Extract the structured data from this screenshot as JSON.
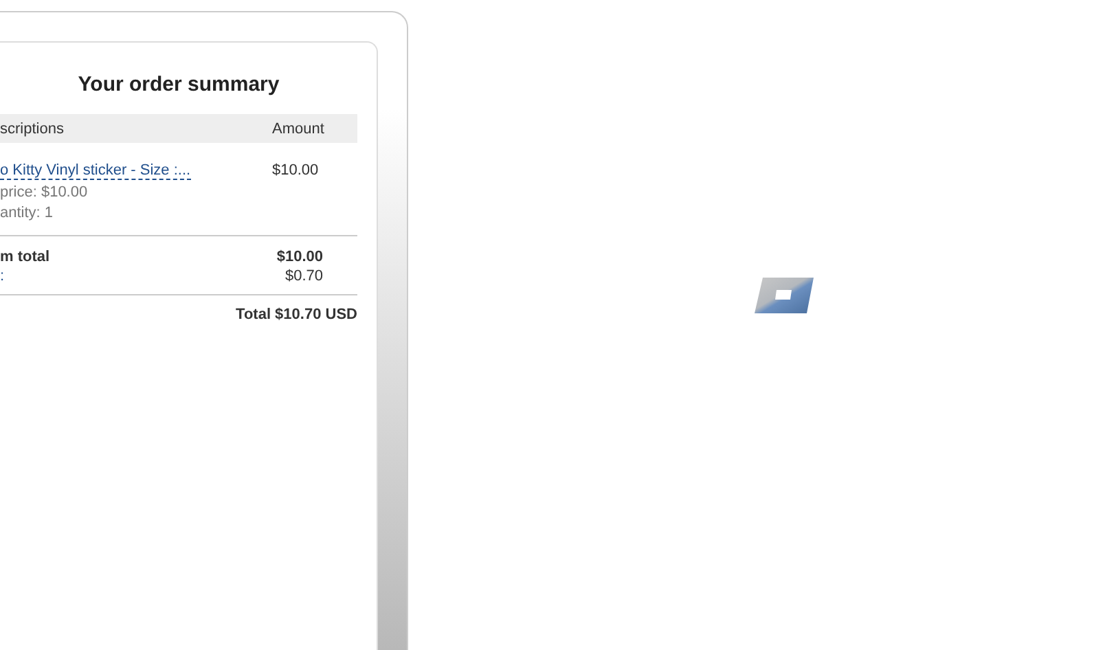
{
  "order_summary": {
    "title": "Your order summary",
    "columns": [
      "scriptions",
      "Amount"
    ],
    "items": [
      {
        "name": "o Kitty Vinyl sticker - Size :...",
        "unit_price": "price: $10.00",
        "quantity": "antity: 1",
        "amount": "$10.00"
      }
    ],
    "totals": [
      {
        "label": "m total",
        "value": "$10.00",
        "bold": true
      },
      {
        "label": ":",
        "value": "$0.70",
        "bold": false
      }
    ],
    "grand_total": "Total $10.70 USD"
  }
}
